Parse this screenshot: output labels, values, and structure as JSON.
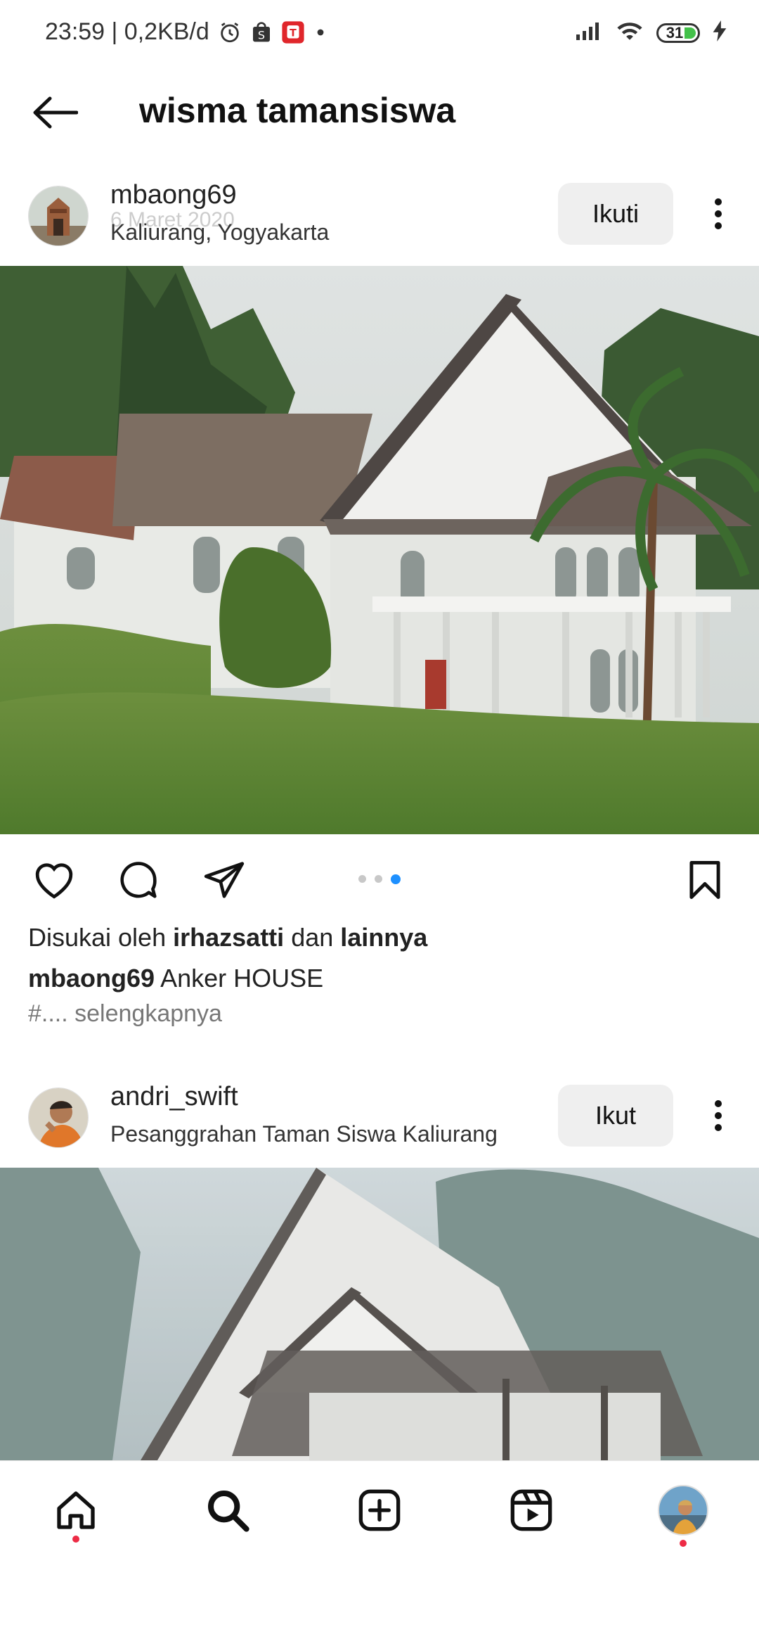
{
  "status_bar": {
    "time_speed": "23:59 | 0,2KB/d",
    "battery": "31"
  },
  "header": {
    "title": "wisma tamansiswa"
  },
  "posts": [
    {
      "username": "mbaong69",
      "date": "6 Maret 2020",
      "location": "Kaliurang, Yogyakarta",
      "follow_label": "Ikuti",
      "carousel": {
        "count": 3,
        "active_index": 2
      },
      "likes": {
        "prefix": "Disukai oleh",
        "user": "irhazsatti",
        "mid": "dan",
        "suffix": "lainnya"
      },
      "caption_user": "mbaong69",
      "caption_text": "Anker HOUSE",
      "caption_more": "#.... selengkapnya"
    },
    {
      "username": "andri_swift",
      "location": "Pesanggrahan Taman Siswa Kaliurang",
      "follow_label": "Ikut"
    }
  ],
  "colors": {
    "accent": "#1e90ff",
    "notification": "#ed2b45",
    "follow_bg": "#efefef"
  },
  "icons": {
    "nav": [
      "home-icon",
      "search-icon",
      "create-icon",
      "reels-icon",
      "profile-avatar"
    ],
    "actions": [
      "heart-icon",
      "comment-icon",
      "share-icon",
      "bookmark-icon"
    ]
  }
}
